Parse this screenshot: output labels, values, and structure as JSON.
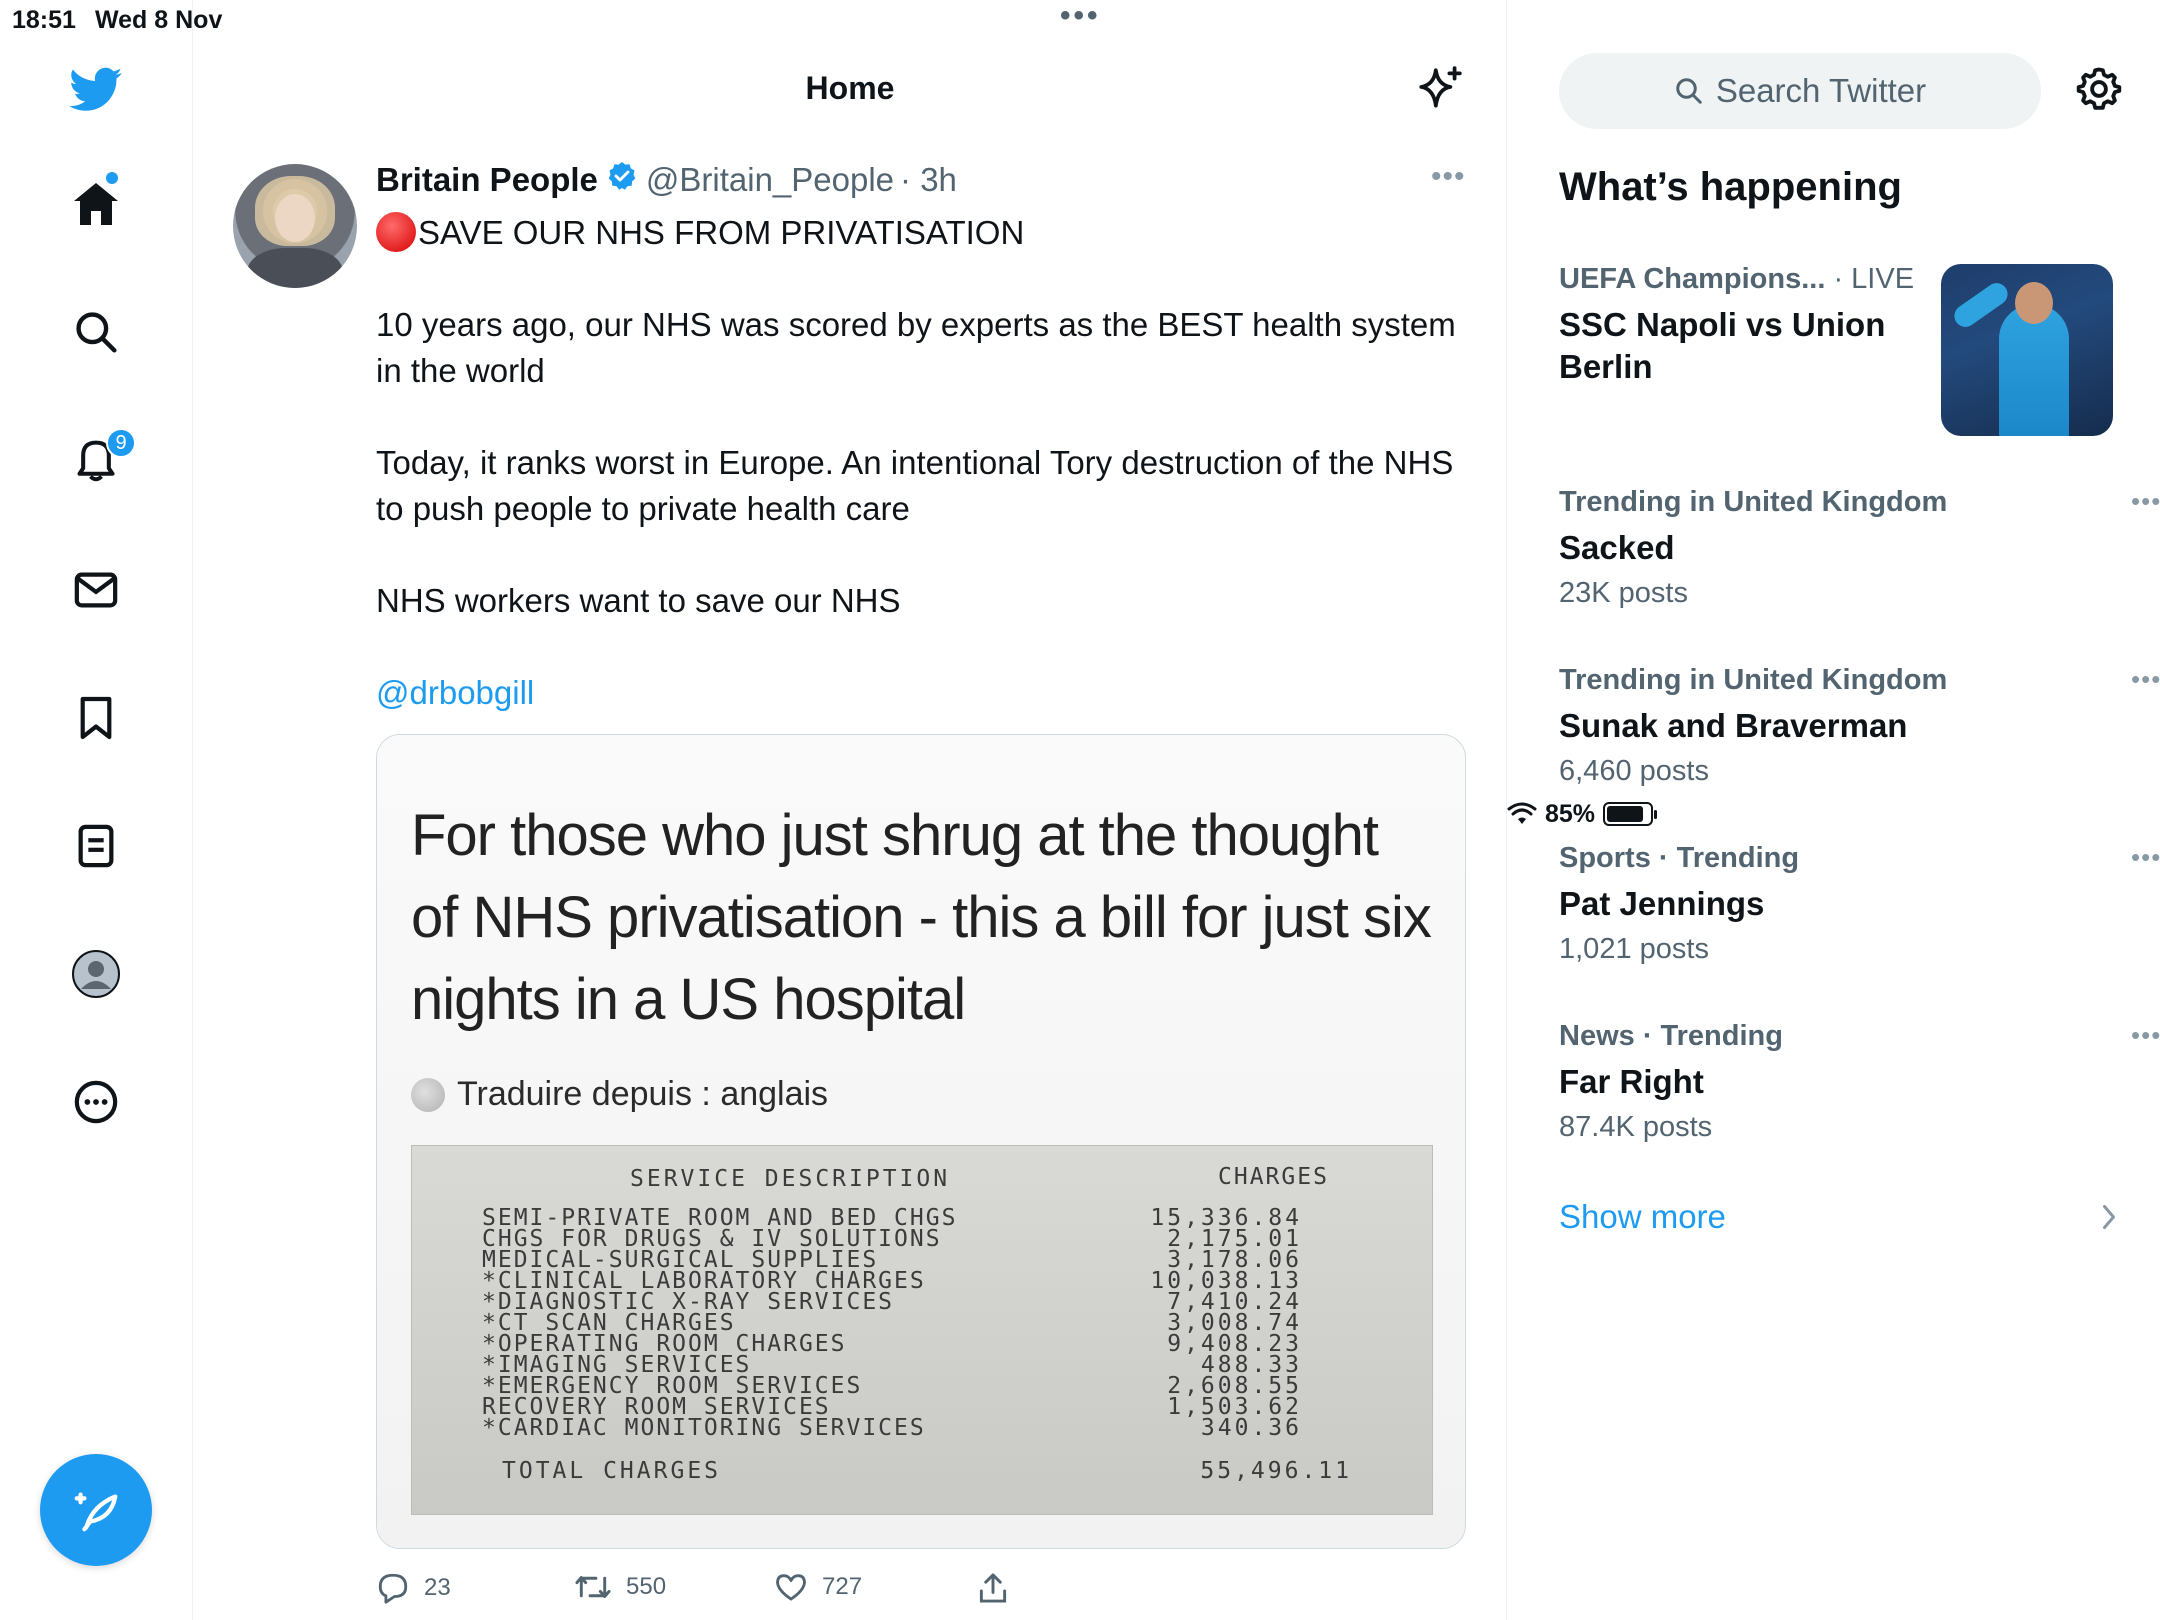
{
  "status_bar": {
    "time": "18:51",
    "date": "Wed 8 Nov",
    "battery": "85%"
  },
  "nav": {
    "notifications_badge": "9"
  },
  "header": {
    "title": "Home"
  },
  "tweet": {
    "author_name": "Britain People",
    "handle": "@Britain_People",
    "time": "· 3h",
    "headline": "SAVE OUR NHS FROM PRIVATISATION",
    "para1": "10 years ago, our NHS was scored by experts as the BEST health system in the world",
    "para2": "Today, it ranks worst in Europe.  An intentional Tory destruction of the NHS to push people to private health care",
    "para3": "NHS workers want to save our NHS",
    "mention": "@drbobgill",
    "media": {
      "heading": "For those who just shrug at the thought of NHS privatisation - this a bill for just six nights in a US hospital",
      "translate": "Traduire depuis : anglais",
      "receipt": {
        "header_desc": "SERVICE DESCRIPTION",
        "header_charges": "CHARGES",
        "rows": [
          {
            "desc": " SEMI-PRIVATE ROOM AND BED CHGS",
            "value": "15,336.84"
          },
          {
            "desc": " CHGS FOR DRUGS & IV SOLUTIONS",
            "value": "2,175.01"
          },
          {
            "desc": " MEDICAL-SURGICAL SUPPLIES",
            "value": "3,178.06"
          },
          {
            "desc": "*CLINICAL LABORATORY CHARGES",
            "value": "10,038.13"
          },
          {
            "desc": "*DIAGNOSTIC X-RAY SERVICES",
            "value": "7,410.24"
          },
          {
            "desc": "*CT SCAN CHARGES",
            "value": "3,008.74"
          },
          {
            "desc": "*OPERATING ROOM CHARGES",
            "value": "9,408.23"
          },
          {
            "desc": "*IMAGING SERVICES",
            "value": "488.33"
          },
          {
            "desc": "*EMERGENCY ROOM SERVICES",
            "value": "2,608.55"
          },
          {
            "desc": " RECOVERY ROOM SERVICES",
            "value": "1,503.62"
          },
          {
            "desc": "*CARDIAC MONITORING SERVICES",
            "value": "340.36"
          }
        ],
        "total_label": "TOTAL CHARGES",
        "total_value": "55,496.11"
      }
    },
    "replies": "23",
    "retweets": "550",
    "likes": "727"
  },
  "sidebar": {
    "search_placeholder": "Search Twitter",
    "whats_happening": "What’s happening",
    "live_trend": {
      "context": "UEFA Champions...",
      "live_label": "· LIVE",
      "title": "SSC Napoli vs Union Berlin"
    },
    "trends": [
      {
        "context": "Trending in United Kingdom",
        "title": "Sacked",
        "count": "23K posts"
      },
      {
        "context": "Trending in United Kingdom",
        "title": "Sunak and Braverman",
        "count": "6,460 posts"
      },
      {
        "context": "Sports · Trending",
        "title": "Pat Jennings",
        "count": "1,021 posts"
      },
      {
        "context": "News · Trending",
        "title": "Far Right",
        "count": "87.4K posts"
      }
    ],
    "show_more": "Show more"
  },
  "colors": {
    "accent": "#1d9bf0",
    "text": "#0f1419",
    "secondary": "#536471"
  }
}
